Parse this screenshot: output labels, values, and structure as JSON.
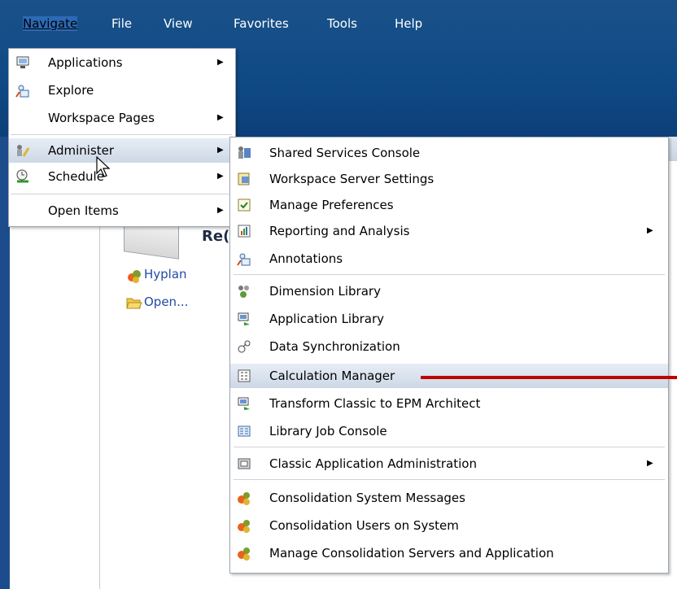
{
  "menubar": {
    "items": [
      {
        "label": "Navigate",
        "active": true
      },
      {
        "label": "File"
      },
      {
        "label": "View"
      },
      {
        "label": "Favorites"
      },
      {
        "label": "Tools"
      },
      {
        "label": "Help"
      }
    ]
  },
  "content": {
    "title": "Re(",
    "links": [
      "Hyplan",
      "Open..."
    ]
  },
  "navigate_menu": {
    "items": [
      {
        "label": "Applications",
        "icon": "monitor-icon",
        "submenu": true
      },
      {
        "label": "Explore",
        "icon": "explore-icon",
        "submenu": false
      },
      {
        "label": "Workspace Pages",
        "icon": "",
        "submenu": true
      },
      {
        "label": "Administer",
        "icon": "administer-icon",
        "submenu": true,
        "highlighted": true
      },
      {
        "label": "Schedule",
        "icon": "schedule-icon",
        "submenu": true
      },
      {
        "label": "Open Items",
        "icon": "",
        "submenu": true
      }
    ]
  },
  "administer_menu": {
    "items": [
      {
        "label": "Shared Services Console",
        "icon": "shared-services-icon",
        "submenu": false
      },
      {
        "label": "Workspace Server Settings",
        "icon": "server-settings-icon",
        "submenu": false
      },
      {
        "label": "Manage Preferences",
        "icon": "preferences-icon",
        "submenu": false
      },
      {
        "label": "Reporting and Analysis",
        "icon": "reporting-icon",
        "submenu": true
      },
      {
        "label": "Annotations",
        "icon": "annotations-icon",
        "submenu": false
      },
      {
        "label": "Dimension Library",
        "icon": "dimension-library-icon",
        "submenu": false
      },
      {
        "label": "Application Library",
        "icon": "application-library-icon",
        "submenu": false
      },
      {
        "label": "Data Synchronization",
        "icon": "data-sync-icon",
        "submenu": false
      },
      {
        "label": "Calculation Manager",
        "icon": "calculation-manager-icon",
        "submenu": false,
        "highlighted": true
      },
      {
        "label": "Transform Classic to EPM Architect",
        "icon": "transform-icon",
        "submenu": false
      },
      {
        "label": "Library Job Console",
        "icon": "job-console-icon",
        "submenu": false
      },
      {
        "label": "Classic Application Administration",
        "icon": "classic-admin-icon",
        "submenu": true
      },
      {
        "label": "Consolidation System Messages",
        "icon": "consolidation-icon",
        "submenu": false
      },
      {
        "label": "Consolidation Users on System",
        "icon": "consolidation-icon",
        "submenu": false
      },
      {
        "label": "Manage Consolidation Servers and Application",
        "icon": "consolidation-icon",
        "submenu": false
      }
    ]
  },
  "colors": {
    "titlebar": "#0f4a86",
    "highlight": "#cdd8e6",
    "annotation_line": "#c00000",
    "link": "#2349a5"
  }
}
